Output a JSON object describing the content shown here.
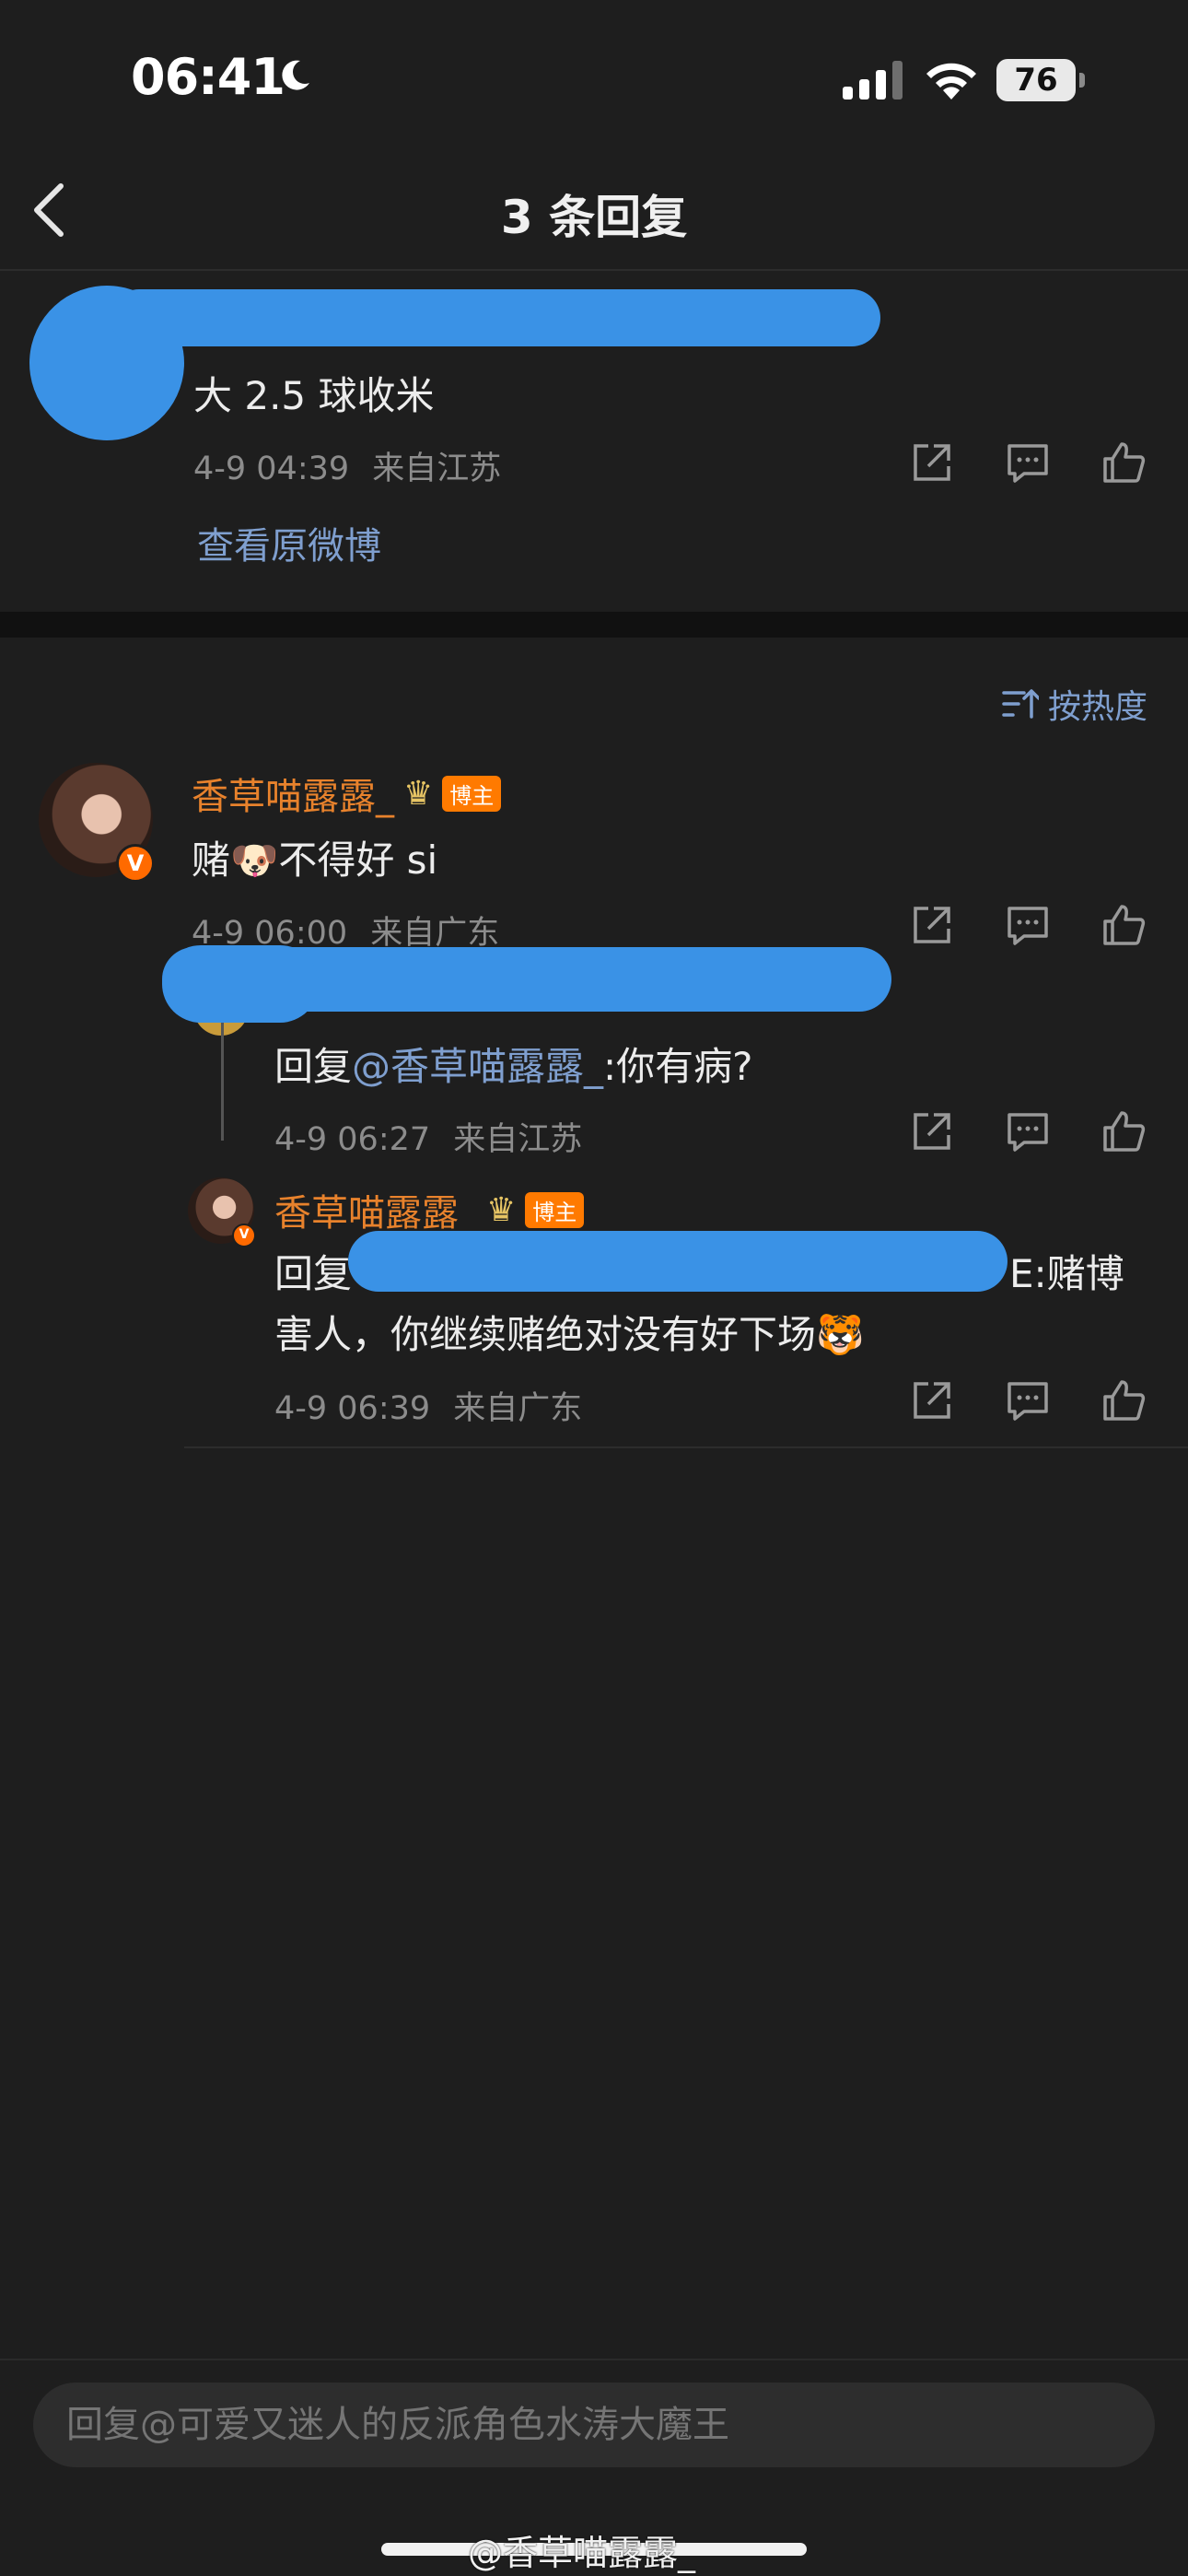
{
  "status_bar": {
    "time": "06:41",
    "battery": "76",
    "icons": [
      "moon-icon",
      "signal-icon",
      "wifi-icon",
      "battery-icon"
    ]
  },
  "nav": {
    "title": "3 条回复",
    "back_icon": "chevron-left-icon"
  },
  "original": {
    "text": "大 2.5 球收米",
    "date": "4-9 04:39",
    "location": "来自江苏",
    "view_original": "查看原微博"
  },
  "sort": {
    "label": "按热度",
    "icon": "sort-icon"
  },
  "comment": {
    "username": "香草喵露露_",
    "badge": "博主",
    "text_before": "赌",
    "emoji": "🐶",
    "text_after": "不得好 si",
    "date": "4-9 06:00",
    "location": "来自广东",
    "verified": "V"
  },
  "reply1": {
    "prefix": "回复",
    "mention": "@香草喵露露_",
    "content": ":你有病?",
    "date": "4-9 06:27",
    "location": "来自江苏"
  },
  "reply2": {
    "username": "香草喵露露_",
    "badge": "博主",
    "prefix": "回复",
    "content_line1_tail": "E:赌博",
    "content_line2": "害人，你继续赌绝对没有好下场",
    "emoji": "🐯",
    "date": "4-9 06:39",
    "location": "来自广东",
    "verified": "V"
  },
  "bottom": {
    "placeholder": "回复@可爱又迷人的反派角色水涛大魔王"
  },
  "watermark": "@香草喵露露_",
  "colors": {
    "background": "#1e1e1e",
    "username": "#e8822c",
    "link": "#7f9fcf",
    "redaction": "#3a92e6",
    "badge": "#ff7a00"
  }
}
